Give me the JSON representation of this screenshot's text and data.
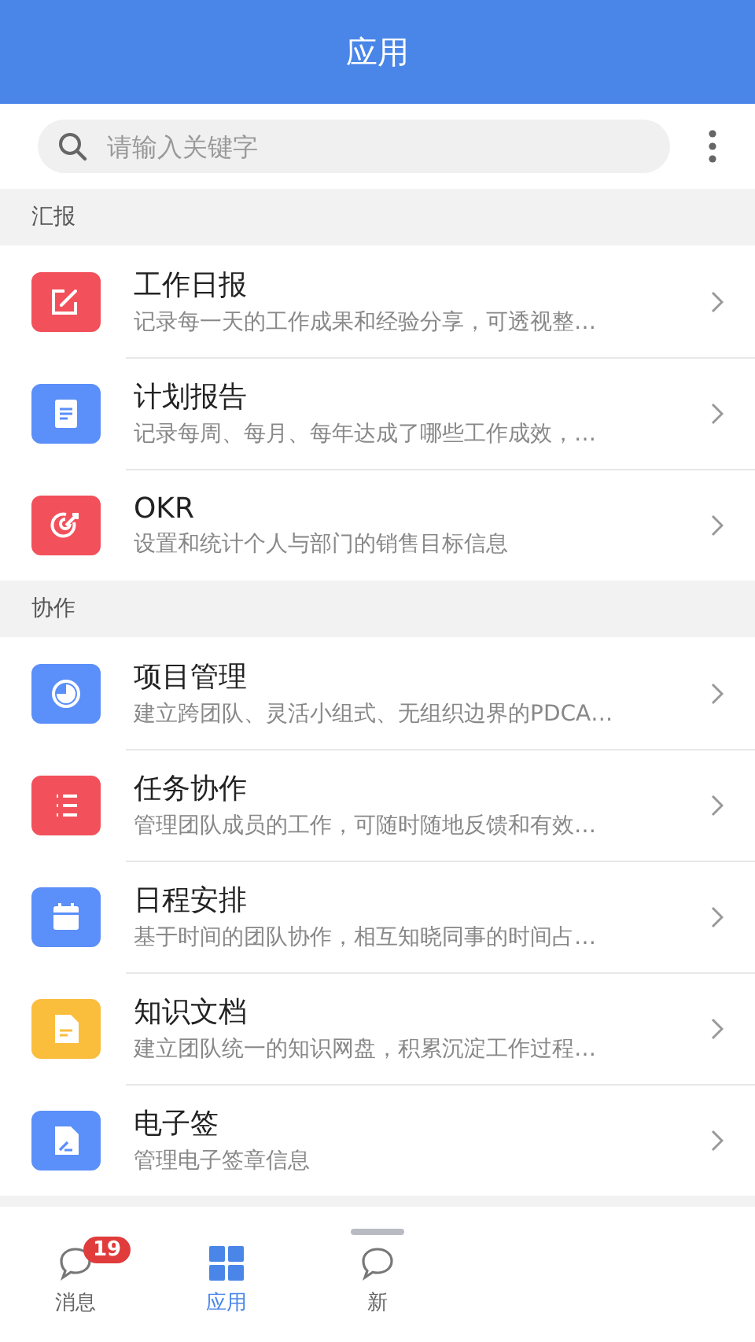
{
  "header": {
    "title": "应用"
  },
  "search": {
    "placeholder": "请输入关键字"
  },
  "sections": [
    {
      "title": "汇报",
      "items": [
        {
          "kind": "edit",
          "color": "#f2505a",
          "title": "工作日报",
          "desc": "记录每一天的工作成果和经验分享，可透视整…"
        },
        {
          "kind": "doc",
          "color": "#5b8ff9",
          "title": "计划报告",
          "desc": "记录每周、每月、每年达成了哪些工作成效，…"
        },
        {
          "kind": "target",
          "color": "#f2505a",
          "title": "OKR",
          "desc": "设置和统计个人与部门的销售目标信息"
        }
      ]
    },
    {
      "title": "协作",
      "items": [
        {
          "kind": "pie",
          "color": "#5b8ff9",
          "title": "项目管理",
          "desc": "建立跨团队、灵活小组式、无组织边界的PDCA…"
        },
        {
          "kind": "list",
          "color": "#f2505a",
          "title": "任务协作",
          "desc": "管理团队成员的工作，可随时随地反馈和有效…"
        },
        {
          "kind": "calendar",
          "color": "#5b8ff9",
          "title": "日程安排",
          "desc": "基于时间的团队协作，相互知晓同事的时间占…"
        },
        {
          "kind": "file",
          "color": "#fbbd3c",
          "title": "知识文档",
          "desc": "建立团队统一的知识网盘，积累沉淀工作过程…"
        },
        {
          "kind": "sign",
          "color": "#5b8ff9",
          "title": "电子签",
          "desc": "管理电子签章信息"
        }
      ]
    }
  ],
  "tabbar": [
    {
      "kind": "chat",
      "label": "消息",
      "badge": "19",
      "selected": false
    },
    {
      "kind": "grid",
      "label": "应用",
      "selected": true
    },
    {
      "kind": "chat",
      "label": "新",
      "selected": false
    }
  ]
}
